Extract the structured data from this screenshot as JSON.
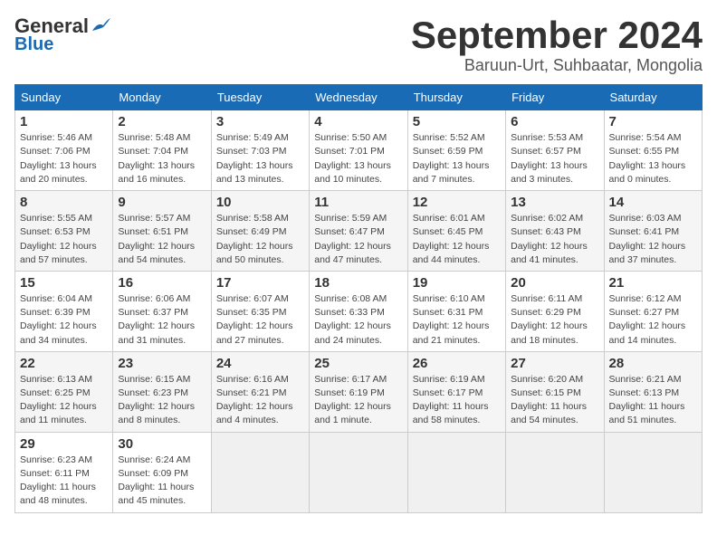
{
  "logo": {
    "general": "General",
    "blue": "Blue",
    "tagline": "Blue"
  },
  "header": {
    "month": "September 2024",
    "location": "Baruun-Urt, Suhbaatar, Mongolia"
  },
  "days_of_week": [
    "Sunday",
    "Monday",
    "Tuesday",
    "Wednesday",
    "Thursday",
    "Friday",
    "Saturday"
  ],
  "weeks": [
    [
      {
        "day": "1",
        "detail": "Sunrise: 5:46 AM\nSunset: 7:06 PM\nDaylight: 13 hours\nand 20 minutes."
      },
      {
        "day": "2",
        "detail": "Sunrise: 5:48 AM\nSunset: 7:04 PM\nDaylight: 13 hours\nand 16 minutes."
      },
      {
        "day": "3",
        "detail": "Sunrise: 5:49 AM\nSunset: 7:03 PM\nDaylight: 13 hours\nand 13 minutes."
      },
      {
        "day": "4",
        "detail": "Sunrise: 5:50 AM\nSunset: 7:01 PM\nDaylight: 13 hours\nand 10 minutes."
      },
      {
        "day": "5",
        "detail": "Sunrise: 5:52 AM\nSunset: 6:59 PM\nDaylight: 13 hours\nand 7 minutes."
      },
      {
        "day": "6",
        "detail": "Sunrise: 5:53 AM\nSunset: 6:57 PM\nDaylight: 13 hours\nand 3 minutes."
      },
      {
        "day": "7",
        "detail": "Sunrise: 5:54 AM\nSunset: 6:55 PM\nDaylight: 13 hours\nand 0 minutes."
      }
    ],
    [
      {
        "day": "8",
        "detail": "Sunrise: 5:55 AM\nSunset: 6:53 PM\nDaylight: 12 hours\nand 57 minutes."
      },
      {
        "day": "9",
        "detail": "Sunrise: 5:57 AM\nSunset: 6:51 PM\nDaylight: 12 hours\nand 54 minutes."
      },
      {
        "day": "10",
        "detail": "Sunrise: 5:58 AM\nSunset: 6:49 PM\nDaylight: 12 hours\nand 50 minutes."
      },
      {
        "day": "11",
        "detail": "Sunrise: 5:59 AM\nSunset: 6:47 PM\nDaylight: 12 hours\nand 47 minutes."
      },
      {
        "day": "12",
        "detail": "Sunrise: 6:01 AM\nSunset: 6:45 PM\nDaylight: 12 hours\nand 44 minutes."
      },
      {
        "day": "13",
        "detail": "Sunrise: 6:02 AM\nSunset: 6:43 PM\nDaylight: 12 hours\nand 41 minutes."
      },
      {
        "day": "14",
        "detail": "Sunrise: 6:03 AM\nSunset: 6:41 PM\nDaylight: 12 hours\nand 37 minutes."
      }
    ],
    [
      {
        "day": "15",
        "detail": "Sunrise: 6:04 AM\nSunset: 6:39 PM\nDaylight: 12 hours\nand 34 minutes."
      },
      {
        "day": "16",
        "detail": "Sunrise: 6:06 AM\nSunset: 6:37 PM\nDaylight: 12 hours\nand 31 minutes."
      },
      {
        "day": "17",
        "detail": "Sunrise: 6:07 AM\nSunset: 6:35 PM\nDaylight: 12 hours\nand 27 minutes."
      },
      {
        "day": "18",
        "detail": "Sunrise: 6:08 AM\nSunset: 6:33 PM\nDaylight: 12 hours\nand 24 minutes."
      },
      {
        "day": "19",
        "detail": "Sunrise: 6:10 AM\nSunset: 6:31 PM\nDaylight: 12 hours\nand 21 minutes."
      },
      {
        "day": "20",
        "detail": "Sunrise: 6:11 AM\nSunset: 6:29 PM\nDaylight: 12 hours\nand 18 minutes."
      },
      {
        "day": "21",
        "detail": "Sunrise: 6:12 AM\nSunset: 6:27 PM\nDaylight: 12 hours\nand 14 minutes."
      }
    ],
    [
      {
        "day": "22",
        "detail": "Sunrise: 6:13 AM\nSunset: 6:25 PM\nDaylight: 12 hours\nand 11 minutes."
      },
      {
        "day": "23",
        "detail": "Sunrise: 6:15 AM\nSunset: 6:23 PM\nDaylight: 12 hours\nand 8 minutes."
      },
      {
        "day": "24",
        "detail": "Sunrise: 6:16 AM\nSunset: 6:21 PM\nDaylight: 12 hours\nand 4 minutes."
      },
      {
        "day": "25",
        "detail": "Sunrise: 6:17 AM\nSunset: 6:19 PM\nDaylight: 12 hours\nand 1 minute."
      },
      {
        "day": "26",
        "detail": "Sunrise: 6:19 AM\nSunset: 6:17 PM\nDaylight: 11 hours\nand 58 minutes."
      },
      {
        "day": "27",
        "detail": "Sunrise: 6:20 AM\nSunset: 6:15 PM\nDaylight: 11 hours\nand 54 minutes."
      },
      {
        "day": "28",
        "detail": "Sunrise: 6:21 AM\nSunset: 6:13 PM\nDaylight: 11 hours\nand 51 minutes."
      }
    ],
    [
      {
        "day": "29",
        "detail": "Sunrise: 6:23 AM\nSunset: 6:11 PM\nDaylight: 11 hours\nand 48 minutes."
      },
      {
        "day": "30",
        "detail": "Sunrise: 6:24 AM\nSunset: 6:09 PM\nDaylight: 11 hours\nand 45 minutes."
      },
      {
        "day": "",
        "detail": ""
      },
      {
        "day": "",
        "detail": ""
      },
      {
        "day": "",
        "detail": ""
      },
      {
        "day": "",
        "detail": ""
      },
      {
        "day": "",
        "detail": ""
      }
    ]
  ]
}
